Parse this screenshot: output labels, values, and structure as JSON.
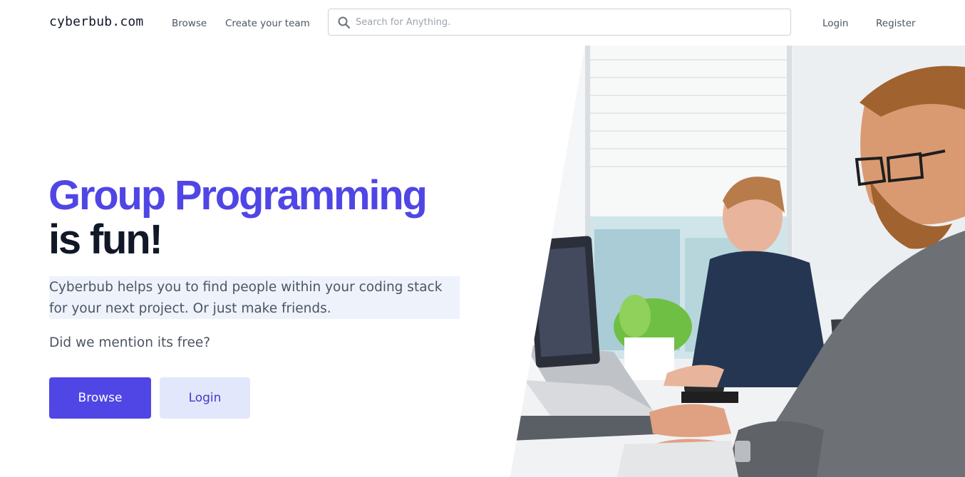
{
  "header": {
    "logo": "cyberbub.com",
    "nav": {
      "browse": "Browse",
      "create_team": "Create your team"
    },
    "search": {
      "placeholder": "Search for Anything."
    },
    "auth": {
      "login": "Login",
      "register": "Register"
    }
  },
  "hero": {
    "title_line1": "Group Programming",
    "title_line2": "is fun!",
    "description": "Cyberbub helps you to find people within your coding stack for your next project. Or just make friends.",
    "free_note": "Did we mention its free?",
    "browse_button": "Browse",
    "login_button": "Login"
  },
  "colors": {
    "accent": "#5046e5",
    "heading_dark": "#111827",
    "secondary_button_bg": "#e3e7fb",
    "highlight_bg": "#eef2fb"
  },
  "icons": {
    "search": "magnifier-icon"
  }
}
